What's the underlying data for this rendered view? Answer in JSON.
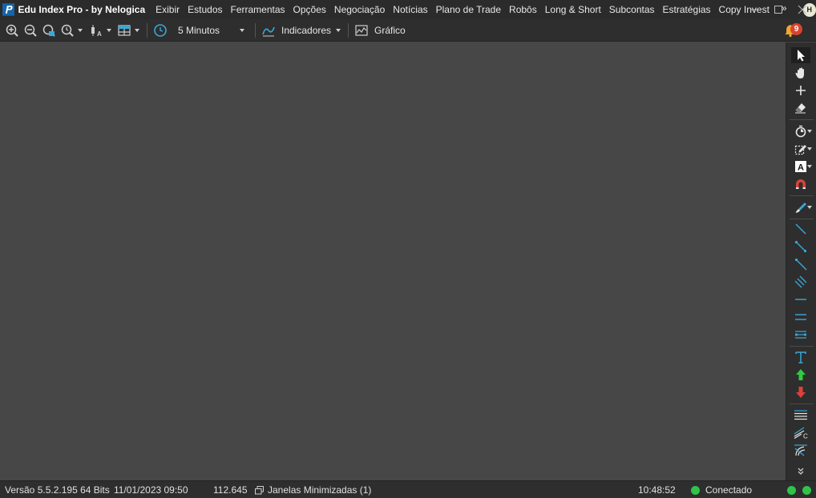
{
  "app": {
    "title": "Edu Index Pro - by Nelogica",
    "user_initial": "H"
  },
  "menu": {
    "items": [
      "Exibir",
      "Estudos",
      "Ferramentas",
      "Opções",
      "Negociação",
      "Notícias",
      "Plano de Trade",
      "Robôs",
      "Long & Short",
      "Subcontas",
      "Estratégias",
      "Copy Invest"
    ],
    "more": "»"
  },
  "toolbar": {
    "timeframe": "5 Minutos",
    "indicators_label": "Indicadores",
    "chart_label": "Gráfico",
    "notification_count": "9"
  },
  "right_toolbar": {
    "tools": [
      "pointer",
      "hand-pan",
      "crosshair",
      "eraser",
      "timer",
      "edit-shape",
      "text-box",
      "magnet",
      "brush",
      "trend-line",
      "segment",
      "ray",
      "parallel-channel",
      "horizontal-line",
      "horizontal-channel",
      "range-line",
      "text",
      "arrow-up",
      "arrow-down",
      "fibonacci-levels",
      "fibonacci-fan",
      "gann-fan",
      "expand"
    ]
  },
  "status": {
    "version": "Versão 5.5.2.195 64 Bits",
    "datetime": "11/01/2023 09:50",
    "value": "112.645",
    "minimized_windows": "Janelas Minimizadas (1)",
    "clock": "10:48:52",
    "connection": "Conectado"
  },
  "colors": {
    "chart_background": "#474747",
    "bar_background": "#2e2e2e",
    "title_background": "#2b2b2b",
    "accent_blue": "#3aa8d8",
    "connected_green": "#2ec44a",
    "badge_red": "#d9432f",
    "arrow_up_green": "#2ecc40",
    "arrow_down_red": "#e0403a"
  }
}
